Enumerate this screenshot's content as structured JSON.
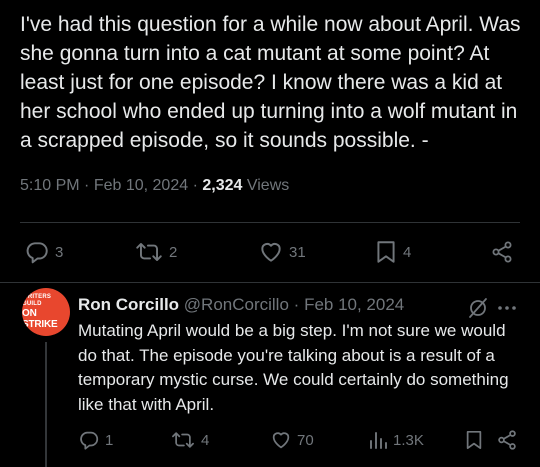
{
  "main_tweet": {
    "text": "I've had this question for a while now about April. Was she gonna turn into a cat mutant at some point? At least just for one episode? I know there was a kid at her school who ended up turning into a wolf mutant in a scrapped episode, so it sounds possible. -",
    "time": "5:10 PM",
    "sep1": "·",
    "date": "Feb 10, 2024",
    "sep2": "·",
    "views_count": "2,324",
    "views_label": "Views",
    "replies": "3",
    "retweets": "2",
    "likes": "31",
    "bookmarks": "4"
  },
  "reply": {
    "avatar_text_small": "WRITERS GUILD",
    "avatar_text_big": "ON STRIKE",
    "name": "Ron Corcillo",
    "handle": "@RonCorcillo",
    "sep": "·",
    "date": "Feb 10, 2024",
    "text": "Mutating April would be a big step. I'm not sure we would do that. The episode you're talking about is a result of a temporary mystic curse. We could certainly do something like that with April.",
    "replies": "1",
    "retweets": "4",
    "likes": "70",
    "views": "1.3K"
  },
  "icons": {
    "reply": "reply-icon",
    "retweet": "retweet-icon",
    "like": "heart-icon",
    "bookmark": "bookmark-icon",
    "share": "share-icon",
    "views": "views-icon",
    "grok": "grok-icon",
    "more": "more-icon"
  },
  "colors": {
    "background": "#000000",
    "text": "#e7e9ea",
    "muted": "#71767b",
    "divider": "#2f3336",
    "avatar": "#e8472e"
  }
}
